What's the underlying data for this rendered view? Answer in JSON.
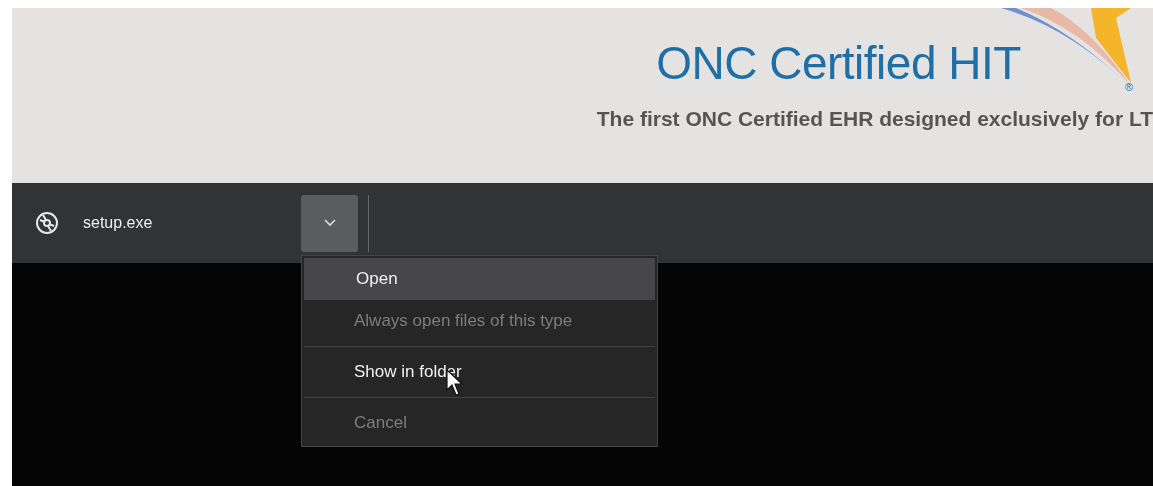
{
  "page_header": {
    "logo_text": "ONC Certified HIT",
    "registered_mark": "®",
    "tagline": "The first ONC Certified EHR designed exclusively for LT"
  },
  "download_bar": {
    "file_name": "setup.exe",
    "menu_open": true
  },
  "context_menu": [
    {
      "kind": "item",
      "label": "Open",
      "selected": true,
      "disabled": false
    },
    {
      "kind": "item",
      "label": "Always open files of this type",
      "selected": false,
      "disabled": true
    },
    {
      "kind": "separator"
    },
    {
      "kind": "item",
      "label": "Show in folder",
      "selected": false,
      "disabled": false
    },
    {
      "kind": "separator"
    },
    {
      "kind": "item",
      "label": "Cancel",
      "selected": false,
      "disabled": true
    }
  ]
}
